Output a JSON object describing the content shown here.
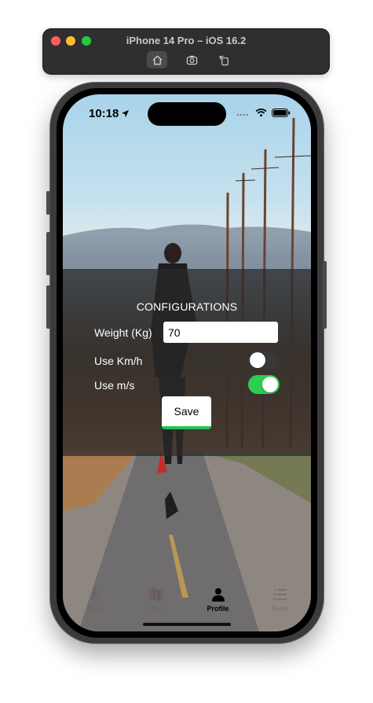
{
  "simulator": {
    "title": "iPhone 14 Pro – iOS 16.2",
    "toolbar_icons": [
      "home-icon",
      "screenshot-icon",
      "rotate-icon"
    ]
  },
  "status_bar": {
    "time": "10:18",
    "icons": [
      "location-arrow-icon",
      "signal-icon",
      "wifi-icon",
      "battery-icon"
    ]
  },
  "config": {
    "title": "CONFIGURATIONS",
    "weight_label": "Weight (Kg)",
    "weight_value": "70",
    "kmh_label": "Use Km/h",
    "kmh_enabled": false,
    "ms_label": "Use m/s",
    "ms_enabled": true,
    "save_label": "Save",
    "accent_color": "#2ecc4f"
  },
  "tabs": [
    {
      "label": "Start",
      "icon": "runner-icon",
      "active": false
    },
    {
      "label": "Map",
      "icon": "map-icon",
      "active": false
    },
    {
      "label": "Profile",
      "icon": "person-icon",
      "active": true
    },
    {
      "label": "Runs",
      "icon": "list-icon",
      "active": false
    }
  ]
}
